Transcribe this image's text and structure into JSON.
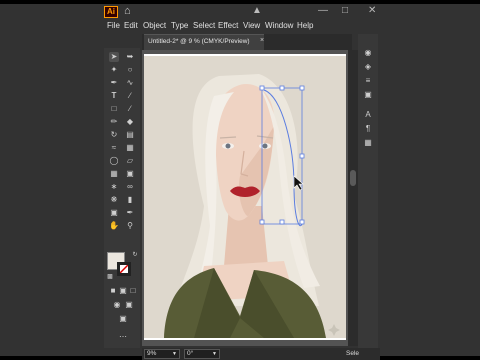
{
  "app": {
    "logo_text": "Ai",
    "menu": [
      "File",
      "Edit",
      "Object",
      "Type",
      "Select",
      "Effect",
      "View",
      "Window",
      "Help"
    ]
  },
  "document": {
    "tab_label": "Untitled-2* @ 9 % (CMYK/Preview)",
    "tab_close": "×"
  },
  "status": {
    "zoom": "9%",
    "angle": "0°",
    "tool_label": "Sele"
  },
  "tools": {
    "left_icons": [
      "selection-icon",
      "direct-selection-icon",
      "magic-wand-icon",
      "lasso-icon",
      "pen-icon",
      "curvature-icon",
      "type-icon",
      "line-icon",
      "rectangle-icon",
      "paintbrush-icon",
      "pencil-icon",
      "eraser-icon",
      "rotate-icon",
      "scale-icon",
      "width-icon",
      "free-transform-icon",
      "shape-builder-icon",
      "perspective-icon",
      "mesh-icon",
      "gradient-icon",
      "eyedropper-icon",
      "blend-icon",
      "symbol-sprayer-icon",
      "column-graph-icon",
      "artboard-icon",
      "slice-icon",
      "hand-icon",
      "zoom-icon"
    ],
    "right_icons": [
      "color-icon",
      "layers-icon",
      "properties-icon",
      "libraries-icon",
      "character-icon",
      "paragraph-icon",
      "transform-icon"
    ]
  },
  "colors": {
    "skin": "#efd3c3",
    "hair": "#efe9df",
    "background": "#ded8cd",
    "jacket": "#585c36",
    "lips": "#b0222b",
    "selection": "#5b7de0"
  }
}
